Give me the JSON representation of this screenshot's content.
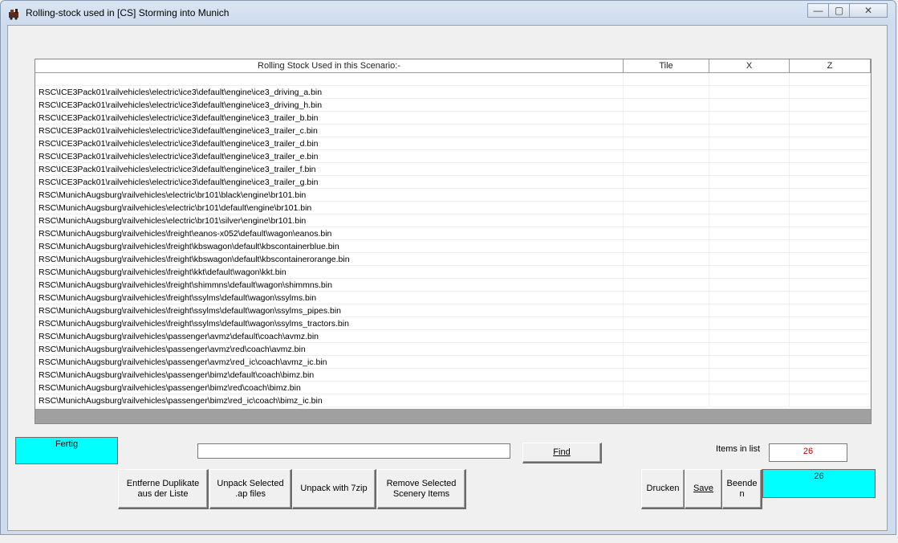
{
  "window": {
    "title": "Rolling-stock used in [CS] Storming into Munich",
    "minimize_glyph": "—",
    "maximize_glyph": "▢",
    "close_glyph": "✕"
  },
  "list": {
    "columns": [
      "Rolling Stock Used in this Scenario:-",
      "Tile",
      "X",
      "Z"
    ],
    "rows": [
      "",
      "RSC\\ICE3Pack01\\railvehicles\\electric\\ice3\\default\\engine\\ice3_driving_a.bin",
      "RSC\\ICE3Pack01\\railvehicles\\electric\\ice3\\default\\engine\\ice3_driving_h.bin",
      "RSC\\ICE3Pack01\\railvehicles\\electric\\ice3\\default\\engine\\ice3_trailer_b.bin",
      "RSC\\ICE3Pack01\\railvehicles\\electric\\ice3\\default\\engine\\ice3_trailer_c.bin",
      "RSC\\ICE3Pack01\\railvehicles\\electric\\ice3\\default\\engine\\ice3_trailer_d.bin",
      "RSC\\ICE3Pack01\\railvehicles\\electric\\ice3\\default\\engine\\ice3_trailer_e.bin",
      "RSC\\ICE3Pack01\\railvehicles\\electric\\ice3\\default\\engine\\ice3_trailer_f.bin",
      "RSC\\ICE3Pack01\\railvehicles\\electric\\ice3\\default\\engine\\ice3_trailer_g.bin",
      "RSC\\MunichAugsburg\\railvehicles\\electric\\br101\\black\\engine\\br101.bin",
      "RSC\\MunichAugsburg\\railvehicles\\electric\\br101\\default\\engine\\br101.bin",
      "RSC\\MunichAugsburg\\railvehicles\\electric\\br101\\silver\\engine\\br101.bin",
      "RSC\\MunichAugsburg\\railvehicles\\freight\\eanos-x052\\default\\wagon\\eanos.bin",
      "RSC\\MunichAugsburg\\railvehicles\\freight\\kbswagon\\default\\kbscontainerblue.bin",
      "RSC\\MunichAugsburg\\railvehicles\\freight\\kbswagon\\default\\kbscontainerorange.bin",
      "RSC\\MunichAugsburg\\railvehicles\\freight\\kkt\\default\\wagon\\kkt.bin",
      "RSC\\MunichAugsburg\\railvehicles\\freight\\shimmns\\default\\wagon\\shimmns.bin",
      "RSC\\MunichAugsburg\\railvehicles\\freight\\ssylms\\default\\wagon\\ssylms.bin",
      "RSC\\MunichAugsburg\\railvehicles\\freight\\ssylms\\default\\wagon\\ssylms_pipes.bin",
      "RSC\\MunichAugsburg\\railvehicles\\freight\\ssylms\\default\\wagon\\ssylms_tractors.bin",
      "RSC\\MunichAugsburg\\railvehicles\\passenger\\avmz\\default\\coach\\avmz.bin",
      "RSC\\MunichAugsburg\\railvehicles\\passenger\\avmz\\red\\coach\\avmz.bin",
      "RSC\\MunichAugsburg\\railvehicles\\passenger\\avmz\\red_ic\\coach\\avmz_ic.bin",
      "RSC\\MunichAugsburg\\railvehicles\\passenger\\bimz\\default\\coach\\bimz.bin",
      "RSC\\MunichAugsburg\\railvehicles\\passenger\\bimz\\red\\coach\\bimz.bin",
      "RSC\\MunichAugsburg\\railvehicles\\passenger\\bimz\\red_ic\\coach\\bimz_ic.bin"
    ]
  },
  "status": {
    "left": "Fertig",
    "right": "26"
  },
  "search": {
    "value": "",
    "find_label": "Find"
  },
  "items": {
    "label": "Items in list",
    "count": "26"
  },
  "buttons": {
    "remove_duplicates": "Entferne Duplikate aus der Liste",
    "unpack_selected": "Unpack Selected .ap files",
    "unpack_7zip": "Unpack with 7zip",
    "remove_scenery": "Remove Selected Scenery Items",
    "print": "Drucken",
    "save": "Save",
    "quit": "Beende n"
  },
  "colors": {
    "status_bg": "#00ffff",
    "count_text": "#c00000"
  }
}
